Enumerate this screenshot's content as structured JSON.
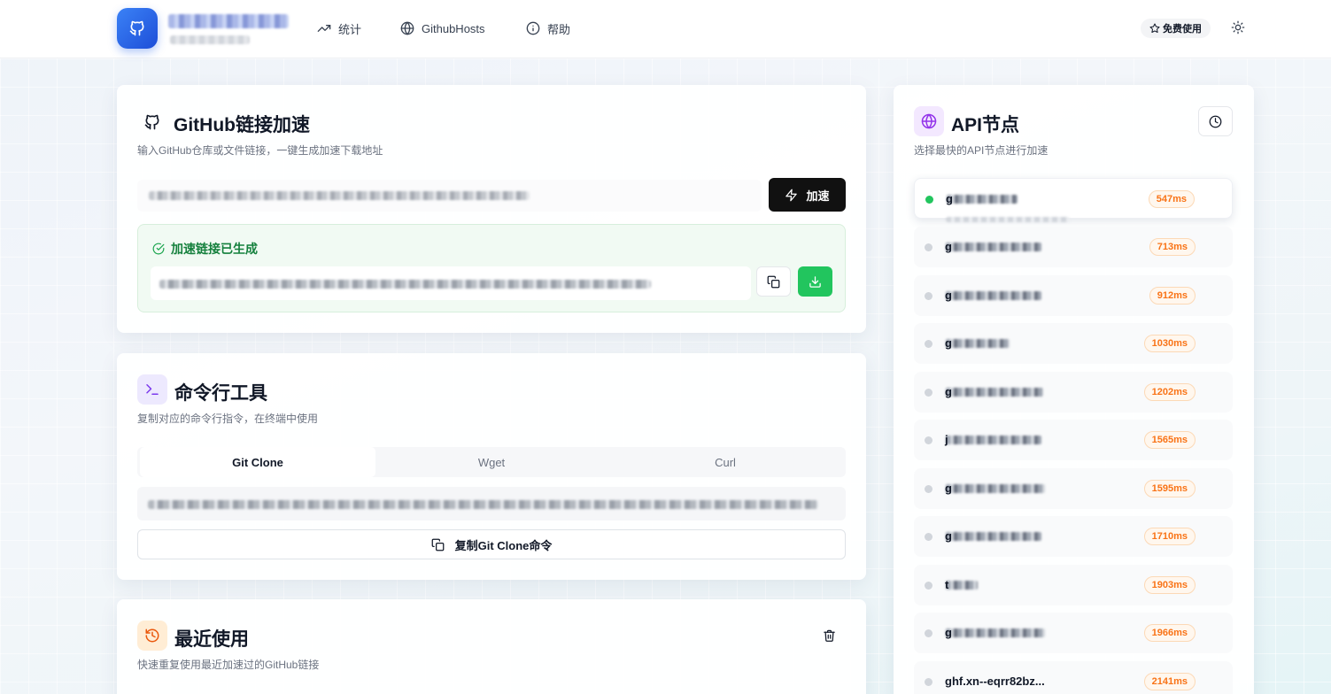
{
  "header": {
    "nav": [
      {
        "label": "统计",
        "icon": "trending-up-icon"
      },
      {
        "label": "GithubHosts",
        "icon": "globe-icon"
      },
      {
        "label": "帮助",
        "icon": "info-icon"
      }
    ],
    "free_label": "免费使用"
  },
  "accelerate": {
    "title": "GitHub链接加速",
    "subtitle": "输入GitHub仓库或文件链接，一键生成加速下载地址",
    "button_label": "加速",
    "success_title": "加速链接已生成"
  },
  "cli": {
    "title": "命令行工具",
    "subtitle": "复制对应的命令行指令，在终端中使用",
    "tabs": [
      "Git Clone",
      "Wget",
      "Curl"
    ],
    "active_tab": "Git Clone",
    "copy_label": "复制Git Clone命令"
  },
  "recent": {
    "title": "最近使用",
    "subtitle": "快速重复使用最近加速过的GitHub链接"
  },
  "api": {
    "title": "API节点",
    "subtitle": "选择最快的API节点进行加速",
    "nodes": [
      {
        "name_initial": "g",
        "latency": "547ms",
        "active": true
      },
      {
        "name_initial": "g",
        "latency": "713ms",
        "active": false
      },
      {
        "name_initial": "g",
        "latency": "912ms",
        "active": false
      },
      {
        "name_initial": "g",
        "latency": "1030ms",
        "active": false
      },
      {
        "name_initial": "g",
        "latency": "1202ms",
        "active": false
      },
      {
        "name_initial": "j",
        "latency": "1565ms",
        "active": false
      },
      {
        "name_initial": "g",
        "latency": "1595ms",
        "active": false
      },
      {
        "name_initial": "g",
        "latency": "1710ms",
        "active": false
      },
      {
        "name_initial": "t",
        "latency": "1903ms",
        "active": false
      },
      {
        "name_initial": "g",
        "latency": "1966ms",
        "active": false
      },
      {
        "name": "ghf.xn--eqrr82bz...",
        "latency": "2141ms",
        "active": false
      }
    ]
  },
  "colors": {
    "accent_blue": "#2563eb",
    "success_green": "#22c55e",
    "latency_orange": "#f97316",
    "button_dark": "#111111"
  }
}
